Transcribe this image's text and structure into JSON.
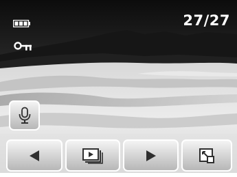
{
  "status": {
    "battery_icon": "battery-full-icon",
    "protect_icon": "key-icon",
    "image_counter": "27/27"
  },
  "controls": {
    "voice_memo_icon": "microphone-icon",
    "previous_icon": "triangle-left-icon",
    "slideshow_icon": "slideshow-icon",
    "next_icon": "triangle-right-icon",
    "zoom_icon": "magnify-corner-icon"
  },
  "colors": {
    "text": "#ffffff",
    "button_top": "#f4f4f4",
    "button_bottom": "#b7b7b7",
    "icon": "#2f2f2f"
  }
}
